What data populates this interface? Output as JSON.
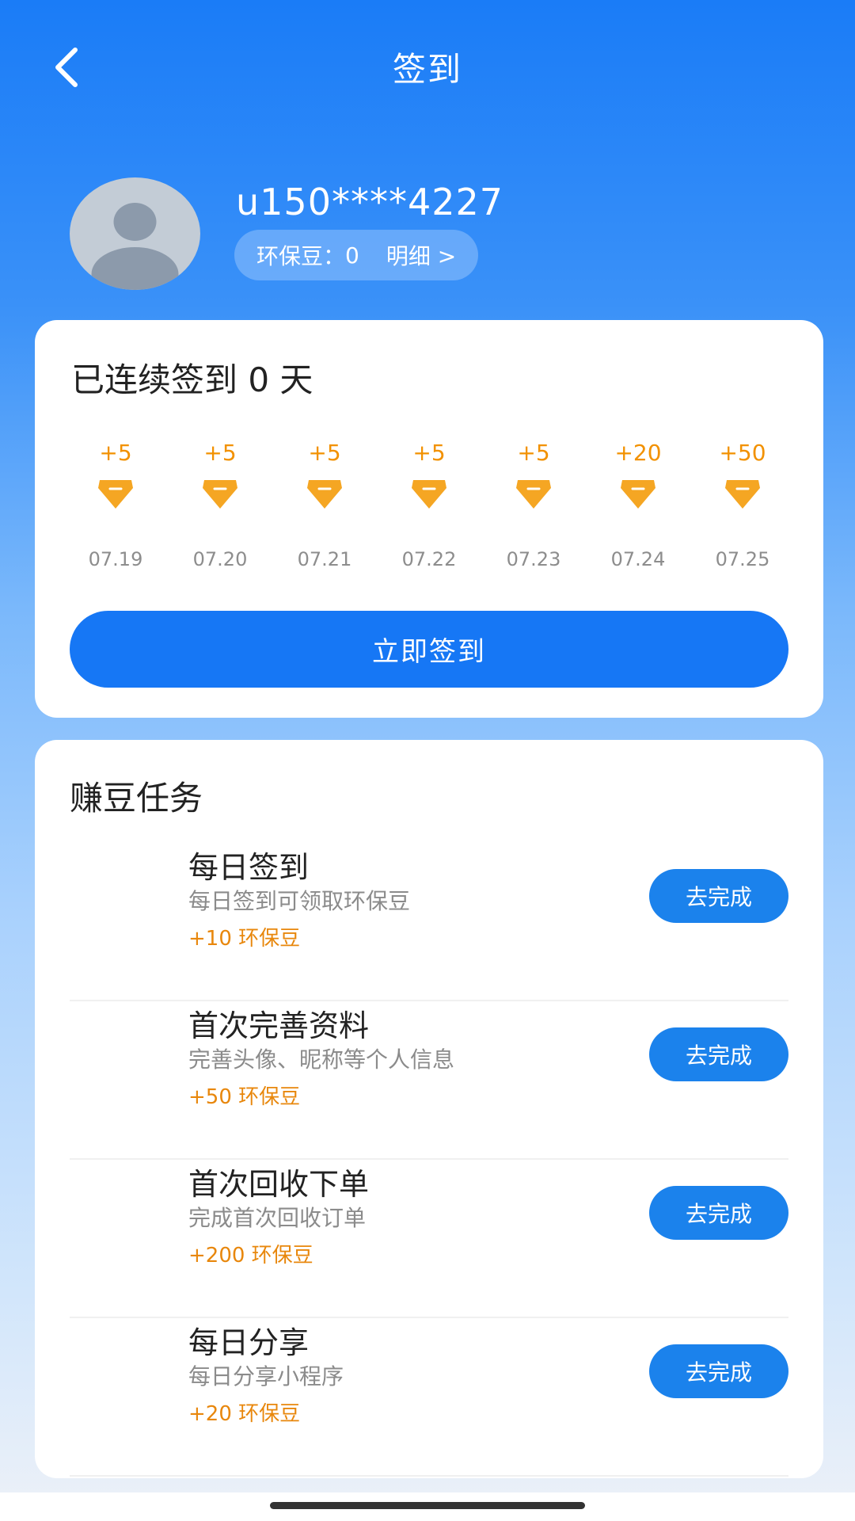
{
  "nav": {
    "title": "签到",
    "back_icon": "chevron-left-icon"
  },
  "profile": {
    "username": "u150****4227",
    "beans_label": "环保豆：",
    "beans_value": "0",
    "detail_link": "明细 >"
  },
  "checkin": {
    "streak_text": "已连续签到 0 天",
    "days": [
      {
        "points": "+5",
        "date": "07.19"
      },
      {
        "points": "+5",
        "date": "07.20"
      },
      {
        "points": "+5",
        "date": "07.21"
      },
      {
        "points": "+5",
        "date": "07.22"
      },
      {
        "points": "+5",
        "date": "07.23"
      },
      {
        "points": "+20",
        "date": "07.24"
      },
      {
        "points": "+50",
        "date": "07.25"
      }
    ],
    "button_label": "立即签到"
  },
  "tasks": {
    "title": "赚豆任务",
    "items": [
      {
        "name": "每日签到",
        "desc": "每日签到可领取环保豆",
        "reward": "+10 环保豆",
        "button": "去完成"
      },
      {
        "name": "首次完善资料",
        "desc": "完善头像、昵称等个人信息",
        "reward": "+50 环保豆",
        "button": "去完成"
      },
      {
        "name": "首次回收下单",
        "desc": "完成首次回收订单",
        "reward": "+200 环保豆",
        "button": "去完成"
      },
      {
        "name": "每日分享",
        "desc": "每日分享小程序",
        "reward": "+20 环保豆",
        "button": "去完成"
      }
    ]
  },
  "colors": {
    "brand_blue": "#1677f5",
    "task_button_blue": "#1b82ec",
    "points_orange": "#f29100",
    "reward_orange": "#e8870c"
  }
}
